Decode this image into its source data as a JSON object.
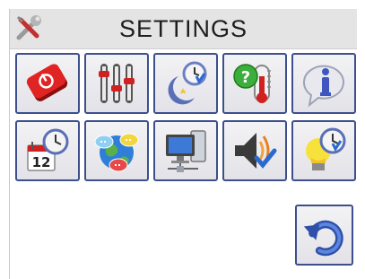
{
  "header": {
    "title": "SETTINGS",
    "icon": "tools-icon"
  },
  "tiles": [
    {
      "name": "power-button-tile",
      "icon": "power-icon"
    },
    {
      "name": "equalizer-tile",
      "icon": "sliders-icon"
    },
    {
      "name": "night-mode-tile",
      "icon": "moon-clock-icon"
    },
    {
      "name": "help-temperature-tile",
      "icon": "help-thermometer-icon"
    },
    {
      "name": "info-tile",
      "icon": "info-icon"
    },
    {
      "name": "calendar-clock-tile",
      "icon": "calendar-clock-icon"
    },
    {
      "name": "network-chat-tile",
      "icon": "globe-chat-icon"
    },
    {
      "name": "computer-network-tile",
      "icon": "computer-network-icon"
    },
    {
      "name": "volume-check-tile",
      "icon": "speaker-check-icon"
    },
    {
      "name": "light-clock-tile",
      "icon": "bulb-clock-icon"
    }
  ],
  "back": {
    "icon": "back-arrow-icon"
  },
  "calendar_day": "12",
  "colors": {
    "tile_border": "#3d4f8c",
    "titlebar_bg": "#e4e4e4",
    "accent_red": "#d02020",
    "accent_blue": "#2a6ad0"
  }
}
